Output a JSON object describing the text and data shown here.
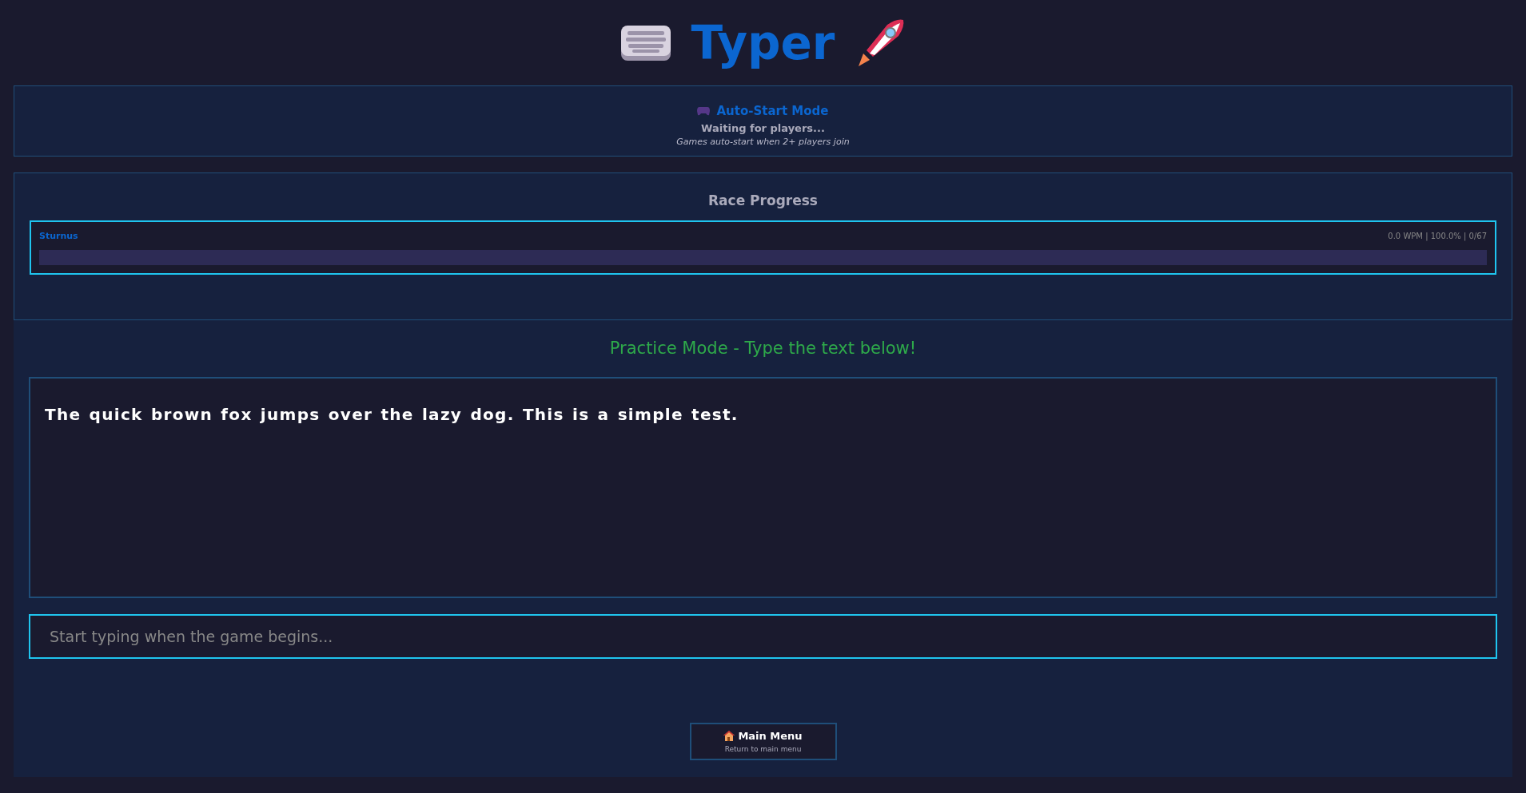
{
  "title": "Typer",
  "status": {
    "heading": "Auto-Start Mode",
    "message": "Waiting for players...",
    "note": "Games auto-start when 2+ players join"
  },
  "race": {
    "heading": "Race Progress",
    "players": [
      {
        "name": "Sturnus",
        "stats": "0.0 WPM | 100.0% | 0/67",
        "level": 0
      }
    ]
  },
  "practice": {
    "heading": "Practice Mode - Type the text below!",
    "text": "The quick brown fox jumps over the lazy dog. This is a simple test.",
    "input": {
      "placeholder": "Start typing when the game begins..."
    }
  },
  "menu_button": {
    "label": "Main Menu",
    "caption": "Return to main menu"
  }
}
